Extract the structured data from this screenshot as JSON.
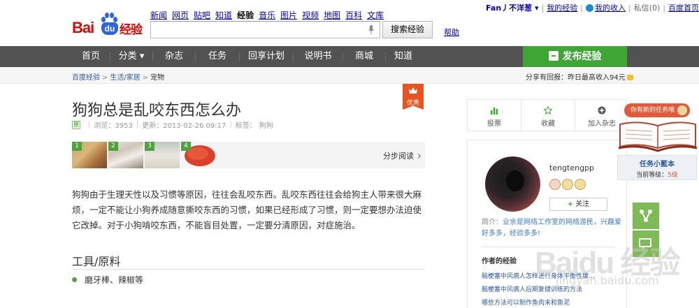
{
  "logo": {
    "text_bai": "Bai",
    "text_du": "du",
    "text_suffix": "经验"
  },
  "top_nav": [
    {
      "label": "新闻",
      "active": false
    },
    {
      "label": "网页",
      "active": false
    },
    {
      "label": "贴吧",
      "active": false
    },
    {
      "label": "知道",
      "active": false
    },
    {
      "label": "经验",
      "active": true
    },
    {
      "label": "音乐",
      "active": false
    },
    {
      "label": "图片",
      "active": false
    },
    {
      "label": "视频",
      "active": false
    },
    {
      "label": "地图",
      "active": false
    },
    {
      "label": "百科",
      "active": false
    },
    {
      "label": "文库",
      "active": false
    }
  ],
  "search": {
    "value": "",
    "button": "搜索经验",
    "help": "帮助"
  },
  "user_bar": {
    "username": "Fan丿不洋葱",
    "my_exp": "我的经验",
    "my_income": "我的收入",
    "messages": "私信(0)",
    "homepage": "百度首页"
  },
  "main_nav": [
    "首页",
    "分类",
    "杂志",
    "任务",
    "回享计划",
    "说明书",
    "商城",
    "知道"
  ],
  "publish": {
    "label": "发布经验"
  },
  "breadcrumb": [
    "百度经验",
    "生活/家居",
    "宠物"
  ],
  "share_text": "分享有回报：昨日最高收入94元",
  "article": {
    "title": "狗狗总是乱咬东西怎么办",
    "badge": "优秀",
    "meta": {
      "tag": "原",
      "views": "浏览：3953",
      "updated": "更新：2013-02-26 09:17",
      "tags": "标签：",
      "tag_value": "狗狗"
    },
    "steps": [
      "1",
      "2",
      "3",
      "4"
    ],
    "step_read": "分步阅读",
    "body": "狗狗由于生理天性以及习惯等原因，往往会乱咬东西。乱咬东西往往会给狗主人带来很大麻烦，一定不能让小狗养成随意撕咬东西的习惯，如果已经形成了习惯，则一定要想办法迫使它改掉。对于小狗啃咬东西，不能盲目处置，一定要分清原因，对症施治。",
    "tools_title": "工具/原料",
    "tools": [
      "磨牙棒、辣椒等"
    ]
  },
  "side_actions": [
    {
      "label": "投票",
      "icon": "bar-chart-icon",
      "color": "#3ea635"
    },
    {
      "label": "收藏",
      "icon": "star-icon",
      "color": "#3ea635"
    },
    {
      "label": "加入杂志",
      "icon": "plus-circle-icon",
      "color": "#555555"
    }
  ],
  "author": {
    "name": "tengtengpp",
    "follow": "关注",
    "intro_label": "简介：",
    "intro": "业余是网络工作室的网络游民，兴趣爱好多多，经验多多!",
    "exp_title": "作者的经验",
    "exp_links": [
      "脑梗塞中风病人怎样进行身体平衡性康…",
      "脑梗塞中风病人后期复健训练的方法",
      "哪些方法可以制作鱼肉末和鱼泥"
    ]
  },
  "task_widget": {
    "bubble": "你有新的任务哦",
    "title": "任务小藍本",
    "level_label": "当前等级：",
    "level": "5级"
  },
  "watermark": {
    "line1": "Baidu 经验",
    "line2": "jingyan.baidu.com"
  }
}
